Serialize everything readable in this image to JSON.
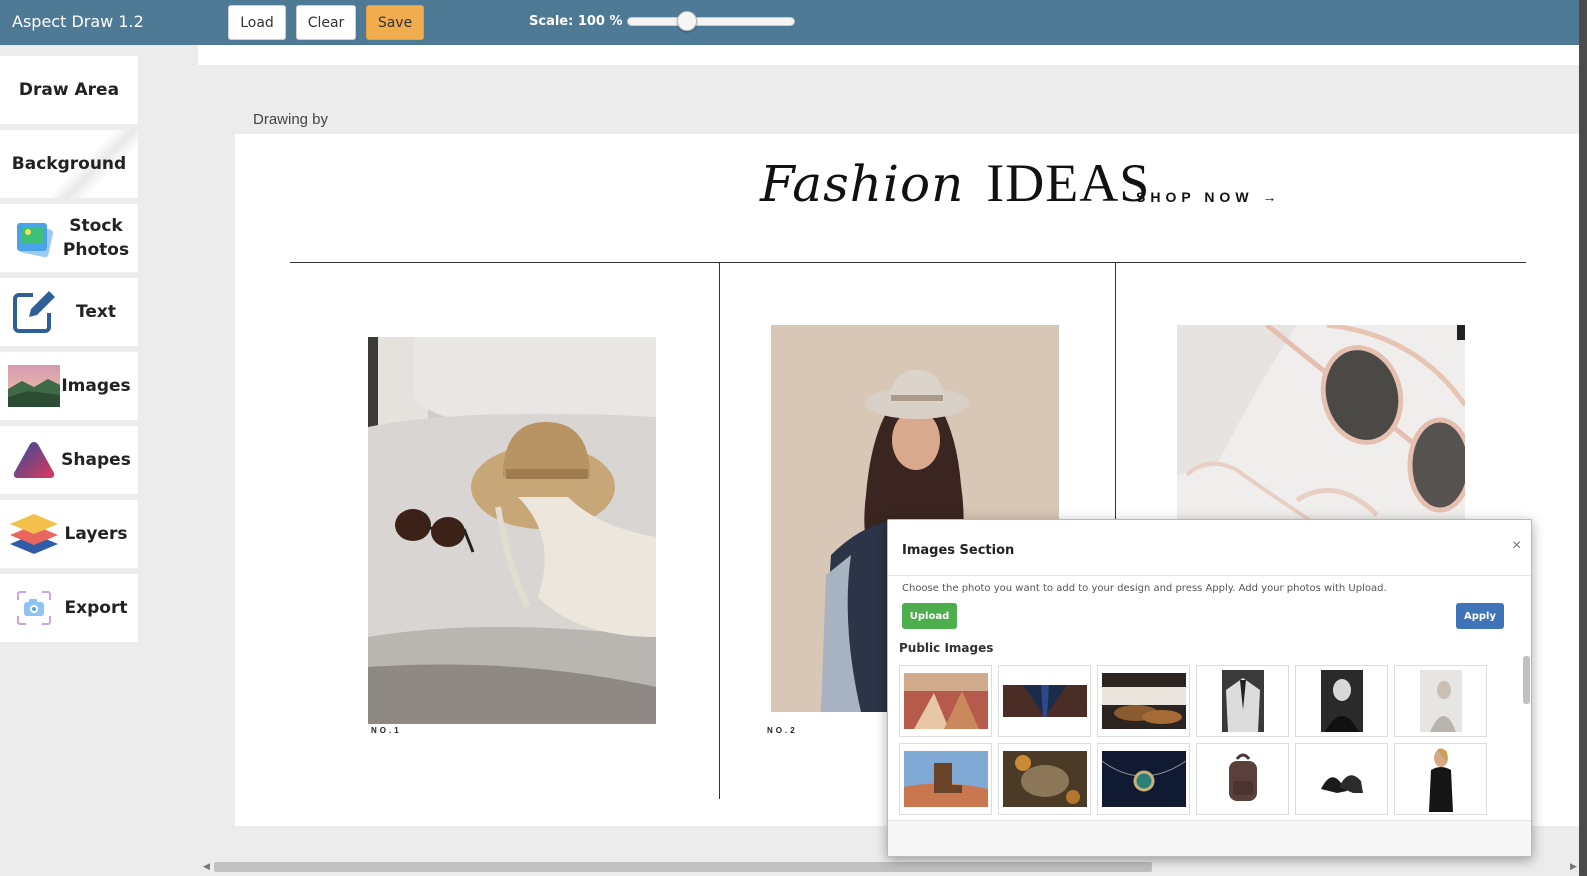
{
  "app": {
    "title": "Aspect Draw  1.2"
  },
  "toolbar": {
    "load_label": "Load",
    "clear_label": "Clear",
    "save_label": "Save",
    "scale_label": "Scale:  100 %",
    "scale_value": 100
  },
  "sidebar": {
    "items": [
      {
        "label": "Draw Area",
        "icon": "none"
      },
      {
        "label": "Background",
        "icon": "none"
      },
      {
        "label": "Stock Photos",
        "icon": "stock-photos-icon"
      },
      {
        "label": "Text",
        "icon": "edit-text-icon"
      },
      {
        "label": "Images",
        "icon": "landscape-image-icon"
      },
      {
        "label": "Shapes",
        "icon": "triangle-shape-icon"
      },
      {
        "label": "Layers",
        "icon": "layers-icon"
      },
      {
        "label": "Export",
        "icon": "camera-export-icon"
      }
    ]
  },
  "canvas": {
    "drawing_by": "Drawing by",
    "headline_script": "Fashion",
    "headline_caps": "IDEAS",
    "shop_now": "SHOP NOW →",
    "items": [
      {
        "number": "NO.1",
        "photo": "straw-hat-sunglasses-photo"
      },
      {
        "number": "NO.2",
        "photo": "woman-in-hat-photo"
      },
      {
        "number": "",
        "photo": "sunglasses-photo"
      }
    ]
  },
  "modal": {
    "title": "Images Section",
    "close": "×",
    "description": "Choose the photo you want to add to your design and press Apply. Add your photos with Upload.",
    "upload_label": "Upload",
    "apply_label": "Apply",
    "public_title": "Public Images",
    "thumbnails": [
      "dancers-thumb",
      "suit-tie-thumb",
      "shoes-thumb",
      "suit-jacket-thumb",
      "woman-portrait-thumb",
      "woman-phone-thumb",
      "boot-desert-thumb",
      "fish-thumb",
      "necklace-thumb",
      "backpack-thumb",
      "heels-thumb",
      "woman-dress-thumb"
    ]
  },
  "colors": {
    "topbar": "#4f7a96",
    "save": "#f0ad4e",
    "upload": "#4cae4c",
    "apply": "#3f74b8"
  }
}
